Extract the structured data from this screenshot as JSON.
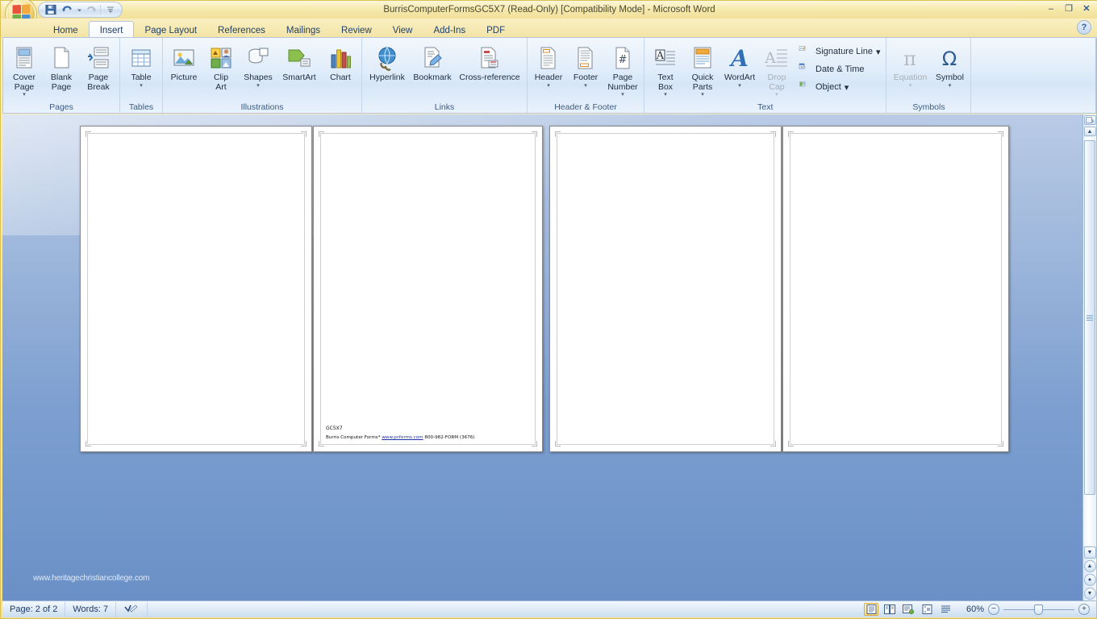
{
  "window": {
    "title": "BurrisComputerFormsGC5X7 (Read-Only) [Compatibility Mode] - Microsoft Word",
    "minimize": "–",
    "maximize": "❐",
    "close": "✕"
  },
  "quick_access": {
    "save": "save-icon",
    "undo": "undo-icon",
    "redo": "redo-icon",
    "customize": "customize-icon"
  },
  "help_button": "?",
  "tabs": [
    {
      "label": "Home",
      "active": false
    },
    {
      "label": "Insert",
      "active": true
    },
    {
      "label": "Page Layout",
      "active": false
    },
    {
      "label": "References",
      "active": false
    },
    {
      "label": "Mailings",
      "active": false
    },
    {
      "label": "Review",
      "active": false
    },
    {
      "label": "View",
      "active": false
    },
    {
      "label": "Add-Ins",
      "active": false
    },
    {
      "label": "PDF",
      "active": false
    }
  ],
  "ribbon": {
    "groups": [
      {
        "name": "Pages",
        "label": "Pages",
        "buttons": [
          {
            "label_line1": "Cover",
            "label_line2": "Page",
            "icon": "cover-page-icon",
            "caret": true,
            "disabled": false
          },
          {
            "label_line1": "Blank",
            "label_line2": "Page",
            "icon": "blank-page-icon",
            "caret": false,
            "disabled": false
          },
          {
            "label_line1": "Page",
            "label_line2": "Break",
            "icon": "page-break-icon",
            "caret": false,
            "disabled": false
          }
        ]
      },
      {
        "name": "Tables",
        "label": "Tables",
        "buttons": [
          {
            "label_line1": "Table",
            "label_line2": "",
            "icon": "table-icon",
            "caret": true,
            "disabled": false
          }
        ]
      },
      {
        "name": "Illustrations",
        "label": "Illustrations",
        "buttons": [
          {
            "label_line1": "Picture",
            "label_line2": "",
            "icon": "picture-icon",
            "caret": false,
            "disabled": false
          },
          {
            "label_line1": "Clip",
            "label_line2": "Art",
            "icon": "clip-art-icon",
            "caret": false,
            "disabled": false
          },
          {
            "label_line1": "Shapes",
            "label_line2": "",
            "icon": "shapes-icon",
            "caret": true,
            "disabled": false
          },
          {
            "label_line1": "SmartArt",
            "label_line2": "",
            "icon": "smartart-icon",
            "caret": false,
            "disabled": false
          },
          {
            "label_line1": "Chart",
            "label_line2": "",
            "icon": "chart-icon",
            "caret": false,
            "disabled": false
          }
        ]
      },
      {
        "name": "Links",
        "label": "Links",
        "buttons": [
          {
            "label_line1": "Hyperlink",
            "label_line2": "",
            "icon": "hyperlink-icon",
            "caret": false,
            "disabled": false
          },
          {
            "label_line1": "Bookmark",
            "label_line2": "",
            "icon": "bookmark-icon",
            "caret": false,
            "disabled": false
          },
          {
            "label_line1": "Cross-reference",
            "label_line2": "",
            "icon": "cross-reference-icon",
            "caret": false,
            "disabled": false
          }
        ]
      },
      {
        "name": "Header & Footer",
        "label": "Header & Footer",
        "buttons": [
          {
            "label_line1": "Header",
            "label_line2": "",
            "icon": "header-icon",
            "caret": true,
            "disabled": false
          },
          {
            "label_line1": "Footer",
            "label_line2": "",
            "icon": "footer-icon",
            "caret": true,
            "disabled": false
          },
          {
            "label_line1": "Page",
            "label_line2": "Number",
            "icon": "page-number-icon",
            "caret": true,
            "disabled": false
          }
        ]
      },
      {
        "name": "Text",
        "label": "Text",
        "buttons": [
          {
            "label_line1": "Text",
            "label_line2": "Box",
            "icon": "text-box-icon",
            "caret": true,
            "disabled": false
          },
          {
            "label_line1": "Quick",
            "label_line2": "Parts",
            "icon": "quick-parts-icon",
            "caret": true,
            "disabled": false
          },
          {
            "label_line1": "WordArt",
            "label_line2": "",
            "icon": "wordart-icon",
            "caret": true,
            "disabled": false
          },
          {
            "label_line1": "Drop",
            "label_line2": "Cap",
            "icon": "drop-cap-icon",
            "caret": true,
            "disabled": true
          }
        ],
        "small_buttons": [
          {
            "label": "Signature Line",
            "icon": "signature-line-icon",
            "caret": true
          },
          {
            "label": "Date & Time",
            "icon": "date-time-icon",
            "caret": false
          },
          {
            "label": "Object",
            "icon": "object-icon",
            "caret": true
          }
        ]
      },
      {
        "name": "Symbols",
        "label": "Symbols",
        "buttons": [
          {
            "label_line1": "Equation",
            "label_line2": "",
            "icon": "equation-icon",
            "caret": true,
            "disabled": true
          },
          {
            "label_line1": "Symbol",
            "label_line2": "",
            "icon": "symbol-icon",
            "caret": true,
            "disabled": false
          }
        ]
      }
    ]
  },
  "document": {
    "form_code": "GC5X7",
    "footer_prefix": "Burris Computer Forms*",
    "footer_link": "www.pcforms.com",
    "footer_phone": "800-982-FORM (3676)",
    "watermark": "www.heritagechristiancollege.com"
  },
  "status_bar": {
    "page": "Page: 2 of 2",
    "words": "Words: 7",
    "proofing_icon": "proofing-errors-icon",
    "views": [
      {
        "name": "print-layout",
        "icon": "print-layout-icon",
        "active": true
      },
      {
        "name": "full-screen-reading",
        "icon": "full-screen-reading-icon",
        "active": false
      },
      {
        "name": "web-layout",
        "icon": "web-layout-icon",
        "active": false
      },
      {
        "name": "outline",
        "icon": "outline-icon",
        "active": false
      },
      {
        "name": "draft",
        "icon": "draft-icon",
        "active": false
      }
    ],
    "zoom": "60%",
    "zoom_out": "−",
    "zoom_in": "+"
  },
  "colors": {
    "titlebar": "#f3e09a",
    "ribbon_bg": "#dcebf9",
    "canvas_bg": "#7d9fd0",
    "accent_blue": "#1f3c64",
    "link": "#1d2fa8"
  }
}
